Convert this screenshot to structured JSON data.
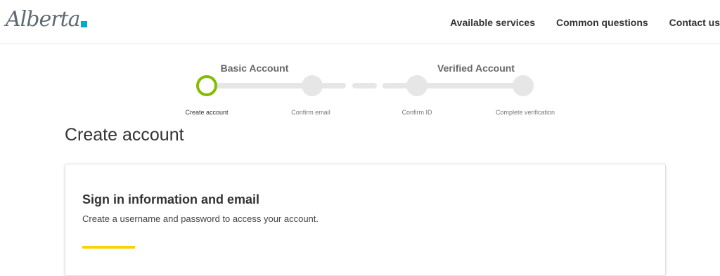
{
  "header": {
    "logo_text": "Alberta",
    "nav": [
      "Available services",
      "Common questions",
      "Contact us"
    ]
  },
  "stepper": {
    "groups": [
      "Basic Account",
      "Verified Account"
    ],
    "steps": [
      "Create account",
      "Confirm email",
      "Confirm ID",
      "Complete verification"
    ],
    "current_step": 1,
    "active_color": "#84bd00"
  },
  "page": {
    "title": "Create account"
  },
  "card": {
    "title": "Sign in information and email",
    "description": "Create a username and password to access your account.",
    "accent_color": "#fed100"
  }
}
